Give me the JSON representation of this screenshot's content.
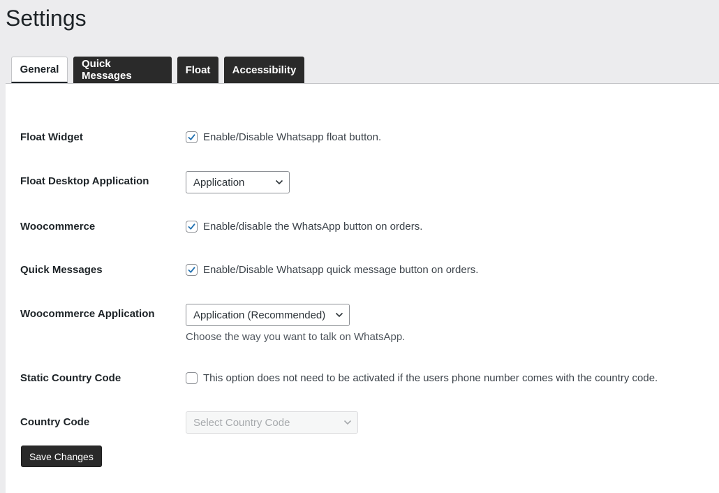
{
  "page": {
    "title": "Settings"
  },
  "tabs": [
    {
      "label": "General",
      "active": true
    },
    {
      "label": "Quick Messages",
      "active": false
    },
    {
      "label": "Float",
      "active": false
    },
    {
      "label": "Accessibility",
      "active": false
    }
  ],
  "settings": {
    "float_widget": {
      "label": "Float Widget",
      "checked": true,
      "text": "Enable/Disable Whatsapp float button."
    },
    "float_desktop_application": {
      "label": "Float Desktop Application",
      "selected": "Application"
    },
    "woocommerce": {
      "label": "Woocommerce",
      "checked": true,
      "text": "Enable/disable the WhatsApp button on orders."
    },
    "quick_messages": {
      "label": "Quick Messages",
      "checked": true,
      "text": "Enable/Disable Whatsapp quick message button on orders."
    },
    "woocommerce_application": {
      "label": "Woocommerce Application",
      "selected": "Application (Recommended)",
      "description": "Choose the way you want to talk on WhatsApp."
    },
    "static_country_code": {
      "label": "Static Country Code",
      "checked": false,
      "text": "This option does not need to be activated if the users phone number comes with the country code."
    },
    "country_code": {
      "label": "Country Code",
      "placeholder": "Select Country Code",
      "disabled": true
    }
  },
  "actions": {
    "save_label": "Save Changes"
  },
  "colors": {
    "accent": "#2271b1",
    "dark_tab": "#2a2a2a",
    "background": "#ececee"
  }
}
